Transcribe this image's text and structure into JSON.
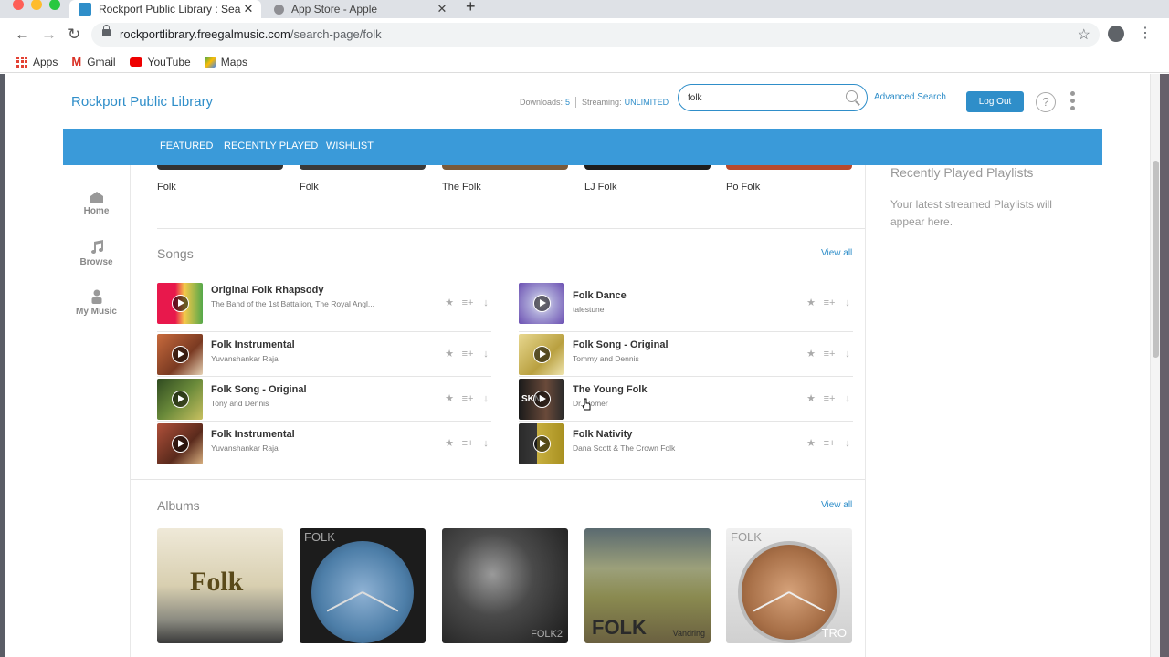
{
  "browser": {
    "tabs": [
      {
        "title": "Rockport Public Library : Searc",
        "close": "✕"
      },
      {
        "title": "App Store - Apple",
        "close": "✕"
      }
    ],
    "new_tab": "+",
    "url_host": "rockportlibrary.freegalmusic.com",
    "url_path": "/search-page/folk",
    "bookmarks": [
      {
        "label": "Apps",
        "icon": "apps-grid-icon"
      },
      {
        "label": "Gmail",
        "icon": "gmail-icon"
      },
      {
        "label": "YouTube",
        "icon": "youtube-icon"
      },
      {
        "label": "Maps",
        "icon": "maps-icon"
      }
    ]
  },
  "header": {
    "brand": "Rockport Public Library",
    "downloads_label": "Downloads:",
    "downloads_value": "5",
    "streaming_label": "Streaming:",
    "streaming_value": "UNLIMITED",
    "search_value": "folk",
    "advanced_search": "Advanced Search",
    "logout": "Log Out",
    "help": "?"
  },
  "navbar": {
    "items": [
      "FEATURED",
      "RECENTLY PLAYED",
      "WISHLIST"
    ]
  },
  "sidenav": {
    "items": [
      {
        "label": "Home",
        "icon": "home-icon"
      },
      {
        "label": "Browse",
        "icon": "music-note-icon"
      },
      {
        "label": "My Music",
        "icon": "user-icon"
      }
    ]
  },
  "top_results": [
    "Folk",
    "Fòlk",
    "The Folk",
    "LJ Folk",
    "Po Folk"
  ],
  "songs": {
    "title": "Songs",
    "view_all": "View all",
    "left": [
      {
        "title": "Original Folk Rhapsody",
        "artist": "The Band of the 1st Battalion, The Royal Angl..."
      },
      {
        "title": "Folk Instrumental",
        "artist": "Yuvanshankar Raja"
      },
      {
        "title": "Folk Song - Original",
        "artist": "Tony and Dennis"
      },
      {
        "title": "Folk Instrumental",
        "artist": "Yuvanshankar Raja"
      }
    ],
    "right": [
      {
        "title": "Folk Dance",
        "artist": "talestune"
      },
      {
        "title": "Folk Song - Original",
        "artist": "Tommy and Dennis"
      },
      {
        "title": "The Young Folk",
        "artist": "Dr. Romer"
      },
      {
        "title": "Folk Nativity",
        "artist": "Dana Scott & The Crown Folk"
      }
    ],
    "actions": {
      "wishlist": "★",
      "add_playlist": "≡+",
      "download": "↓"
    }
  },
  "albums": {
    "title": "Albums",
    "view_all": "View all",
    "cover_texts": [
      "Folk",
      "FOLK",
      "FOLK",
      "Vandring",
      "FOLK",
      "TRO",
      "FOLK2",
      "SKN"
    ]
  },
  "right_pane": {
    "title": "Recently Played Playlists",
    "text": "Your latest streamed Playlists will appear here."
  },
  "colors": {
    "brand": "#2f8ec9",
    "navbar": "#3a9ad9",
    "logout_button": "#2f8ec9"
  }
}
